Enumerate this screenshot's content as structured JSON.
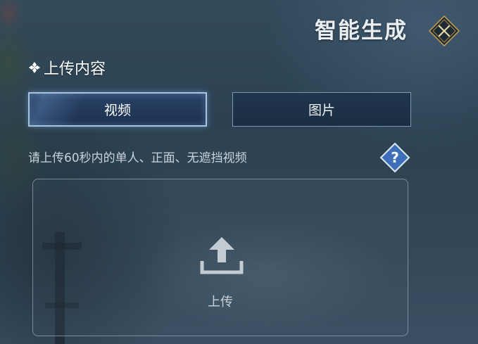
{
  "header": {
    "title": "智能生成",
    "close_icon": "close-diamond-icon"
  },
  "upload_section": {
    "heading": "上传内容",
    "bullet_icon": "diamond-bullet-icon"
  },
  "tabs": [
    {
      "label": "视频",
      "selected": true
    },
    {
      "label": "图片",
      "selected": false
    }
  ],
  "hint": {
    "text": "请上传60秒内的单人、正面、无遮挡视频",
    "help_icon": "question-diamond-icon"
  },
  "upload_zone": {
    "icon": "upload-icon",
    "label": "上传"
  },
  "colors": {
    "accent_gold": "#c9a24a",
    "selected_tab_border": "#a9c3dc",
    "help_blue": "#3f6fb8"
  }
}
